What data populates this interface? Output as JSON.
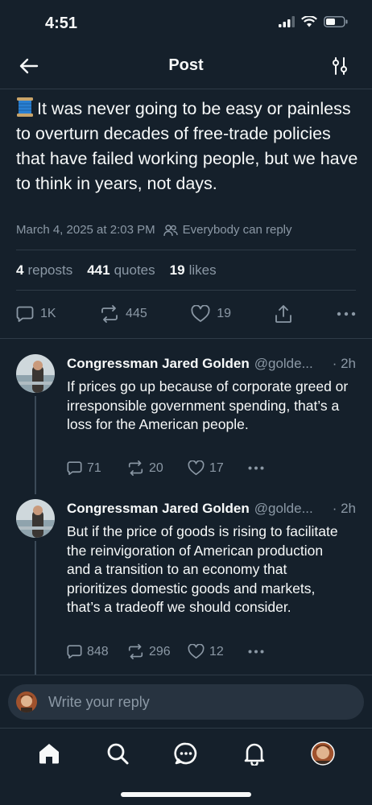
{
  "status_bar": {
    "time": "4:51"
  },
  "header": {
    "title": "Post"
  },
  "post": {
    "text": "It was never going to be easy or painless to overturn decades of free-trade policies that have failed working people, but we have to think in years, not days.",
    "timestamp": "March 4, 2025 at 2:03 PM",
    "reply_permission": "Everybody can reply",
    "stats": {
      "reposts_count": "4",
      "reposts_label": "reposts",
      "quotes_count": "441",
      "quotes_label": "quotes",
      "likes_count": "19",
      "likes_label": "likes"
    },
    "actions": {
      "replies": "1K",
      "reposts": "445",
      "likes": "19"
    }
  },
  "replies": [
    {
      "name": "Congressman Jared Golden",
      "handle": "@golde...",
      "time": "· 2h",
      "text": "If prices go up because of corporate greed or irresponsible government spending, that’s a loss for the American people.",
      "replies": "71",
      "reposts": "20",
      "likes": "17"
    },
    {
      "name": "Congressman Jared Golden",
      "handle": "@golde...",
      "time": "· 2h",
      "text": "But if the price of goods is rising to facilitate the reinvigoration of American production and a transition to an economy that prioritizes domestic goods and markets, that’s a tradeoff we should consider.",
      "replies": "848",
      "reposts": "296",
      "likes": "12"
    }
  ],
  "reply_bar": {
    "placeholder": "Write your reply"
  },
  "tabs": [
    "home",
    "search",
    "messages",
    "notifications",
    "profile"
  ],
  "colors": {
    "background": "#15202b",
    "text": "#f7f9f9",
    "muted": "#8b98a5",
    "divider": "#2f3b47"
  }
}
